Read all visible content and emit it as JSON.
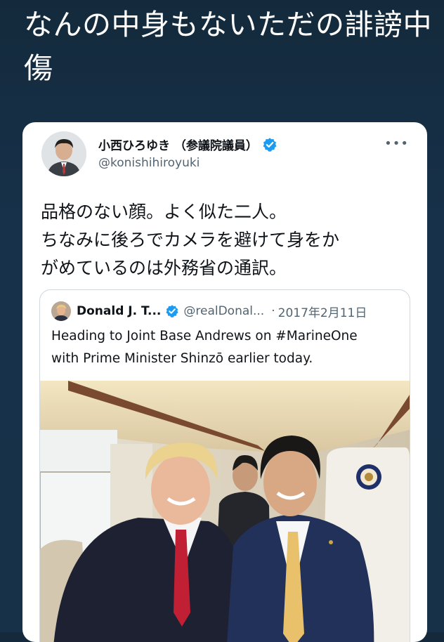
{
  "headline": "なんの中身もないただの誹謗中傷",
  "tweet": {
    "display_name": "小西ひろゆき （参議院議員）",
    "handle": "@konishihiroyuki",
    "more_icon": "more-horizontal-icon",
    "text_lines": [
      "品格のない顔。よく似た二人。",
      "ちなみに後ろでカメラを避けて身をか",
      "がめているのは外務省の通訳。"
    ]
  },
  "quoted_tweet": {
    "display_name": "Donald J. T...",
    "handle": "@realDonal...",
    "separator": "·",
    "date": "2017年2月11日",
    "text_lines": [
      "Heading to Joint Base Andrews on #MarineOne",
      "with Prime Minister Shinzō earlier today."
    ]
  },
  "colors": {
    "background": "#173149",
    "verified": "#1d9bf0",
    "text": "#0f1419",
    "secondary_text": "#536471"
  }
}
